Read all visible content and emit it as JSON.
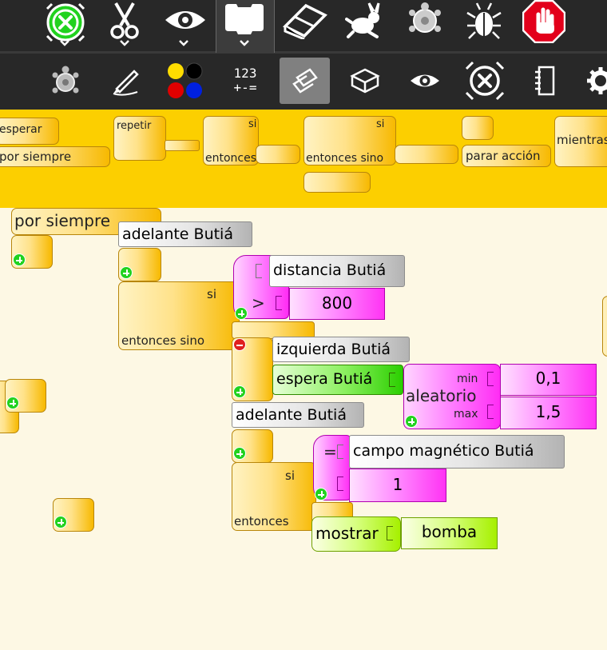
{
  "toolbar_top": {
    "icons": [
      "activity-close-icon",
      "scissors-icon",
      "eye-icon",
      "blocks-tab-icon",
      "eraser-icon",
      "rabbit-run-icon",
      "turtle-debug-icon",
      "bug-icon",
      "stop-icon"
    ]
  },
  "toolbar_sub": {
    "number_label_top": "123",
    "number_label_bottom": "+-=",
    "icons": [
      "turtle-icon",
      "pen-icon",
      "color-palette-icon",
      "number-palette-icon",
      "sensors-palette-icon",
      "extras-icon",
      "show-icon",
      "close-circle-icon",
      "notebook-icon",
      "settings-icon"
    ]
  },
  "palette": {
    "blocks": {
      "wait": "esperar",
      "forever": "por siempre",
      "repeat": "repetir",
      "if_label": "si",
      "then": "entonces",
      "if2_label": "si",
      "then_else": "entonces sino",
      "stop_action": "parar acción",
      "while": "mientras"
    }
  },
  "canvas": {
    "forever": "por siempre",
    "forward1": "adelante Butiá",
    "if1_si": "si",
    "if1_then_else": "entonces sino",
    "distance": "distancia Butiá",
    "greater_op": ">",
    "value_800": "800",
    "left": "izquierda Butiá",
    "wait_butia": "espera Butiá",
    "random": "aleatorio",
    "min_label": "min",
    "max_label": "max",
    "min_value": "0,1",
    "max_value": "1,5",
    "forward2": "adelante Butiá",
    "if2_si": "si",
    "if2_then": "entonces",
    "equals_op": "=",
    "magnetic": "campo magnético Butiá",
    "value_1": "1",
    "show": "mostrar",
    "bomb": "bomba"
  },
  "colors": {
    "toolbar": "#282828",
    "palette_bg": "#fccf00",
    "canvas_bg": "#fdf8e4",
    "flow_block": "#f7b900",
    "sensor_block": "#b3b3b3",
    "number_block": "#ff2cf4",
    "media_block": "#a6f000",
    "stop_red": "#e3001b",
    "active_green": "#21d21f"
  }
}
